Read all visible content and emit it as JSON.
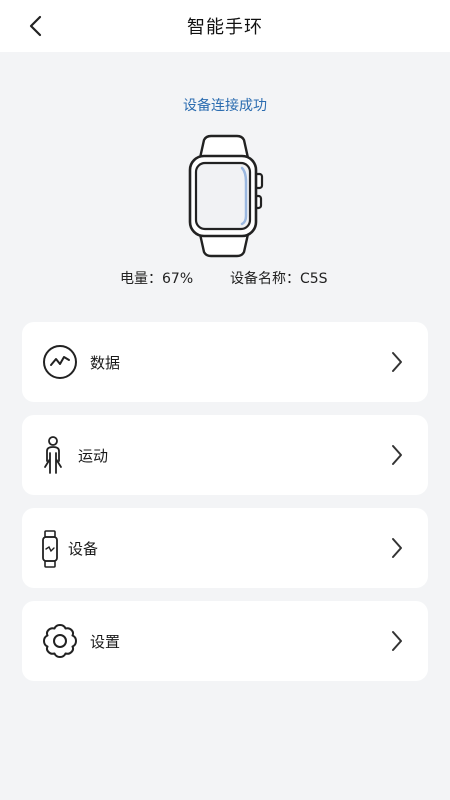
{
  "header": {
    "title": "智能手环",
    "back_icon": "chevron-left-icon"
  },
  "device": {
    "status_text": "设备连接成功",
    "battery_label": "电量：67%",
    "battery_percent": 67,
    "name_label": "设备名称：C5S",
    "image_icon": "smartwatch-icon"
  },
  "menu": [
    {
      "label": "数据",
      "icon": "chart-line-icon"
    },
    {
      "label": "运动",
      "icon": "person-walking-icon"
    },
    {
      "label": "设备",
      "icon": "fitness-band-icon"
    },
    {
      "label": "设置",
      "icon": "gear-icon"
    }
  ],
  "colors": {
    "accent": "#2b6cb0",
    "background": "#f3f4f6",
    "card": "#ffffff"
  }
}
